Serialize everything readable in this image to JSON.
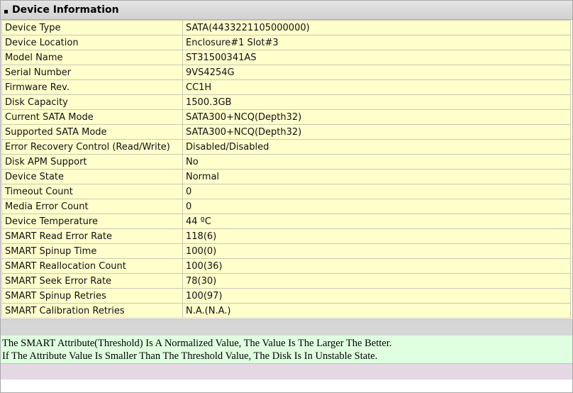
{
  "panel": {
    "title": "Device Information"
  },
  "rows": [
    {
      "label": "Device Type",
      "value": "SATA(4433221105000000)"
    },
    {
      "label": "Device Location",
      "value": "Enclosure#1 Slot#3"
    },
    {
      "label": "Model Name",
      "value": "ST31500341AS"
    },
    {
      "label": "Serial Number",
      "value": "9VS4254G"
    },
    {
      "label": "Firmware Rev.",
      "value": "CC1H"
    },
    {
      "label": "Disk Capacity",
      "value": "1500.3GB"
    },
    {
      "label": "Current SATA Mode",
      "value": "SATA300+NCQ(Depth32)"
    },
    {
      "label": "Supported SATA Mode",
      "value": "SATA300+NCQ(Depth32)"
    },
    {
      "label": "Error Recovery Control (Read/Write)",
      "value": "Disabled/Disabled"
    },
    {
      "label": "Disk APM Support",
      "value": "No"
    },
    {
      "label": "Device State",
      "value": "Normal"
    },
    {
      "label": "Timeout Count",
      "value": "0"
    },
    {
      "label": "Media Error Count",
      "value": "0"
    },
    {
      "label": "Device Temperature",
      "value": "44 ºC"
    },
    {
      "label": "SMART Read Error Rate",
      "value": "118(6)"
    },
    {
      "label": "SMART Spinup Time",
      "value": "100(0)"
    },
    {
      "label": "SMART Reallocation Count",
      "value": "100(36)"
    },
    {
      "label": "SMART Seek Error Rate",
      "value": "78(30)"
    },
    {
      "label": "SMART Spinup Retries",
      "value": "100(97)"
    },
    {
      "label": "SMART Calibration Retries",
      "value": "N.A.(N.A.)"
    }
  ],
  "notes": {
    "line1": "The SMART Attribute(Threshold) Is A Normalized Value, The Value Is The Larger The Better.",
    "line2": "If The Attribute Value Is Smaller Than The Threshold Value, The Disk Is In Unstable State."
  }
}
